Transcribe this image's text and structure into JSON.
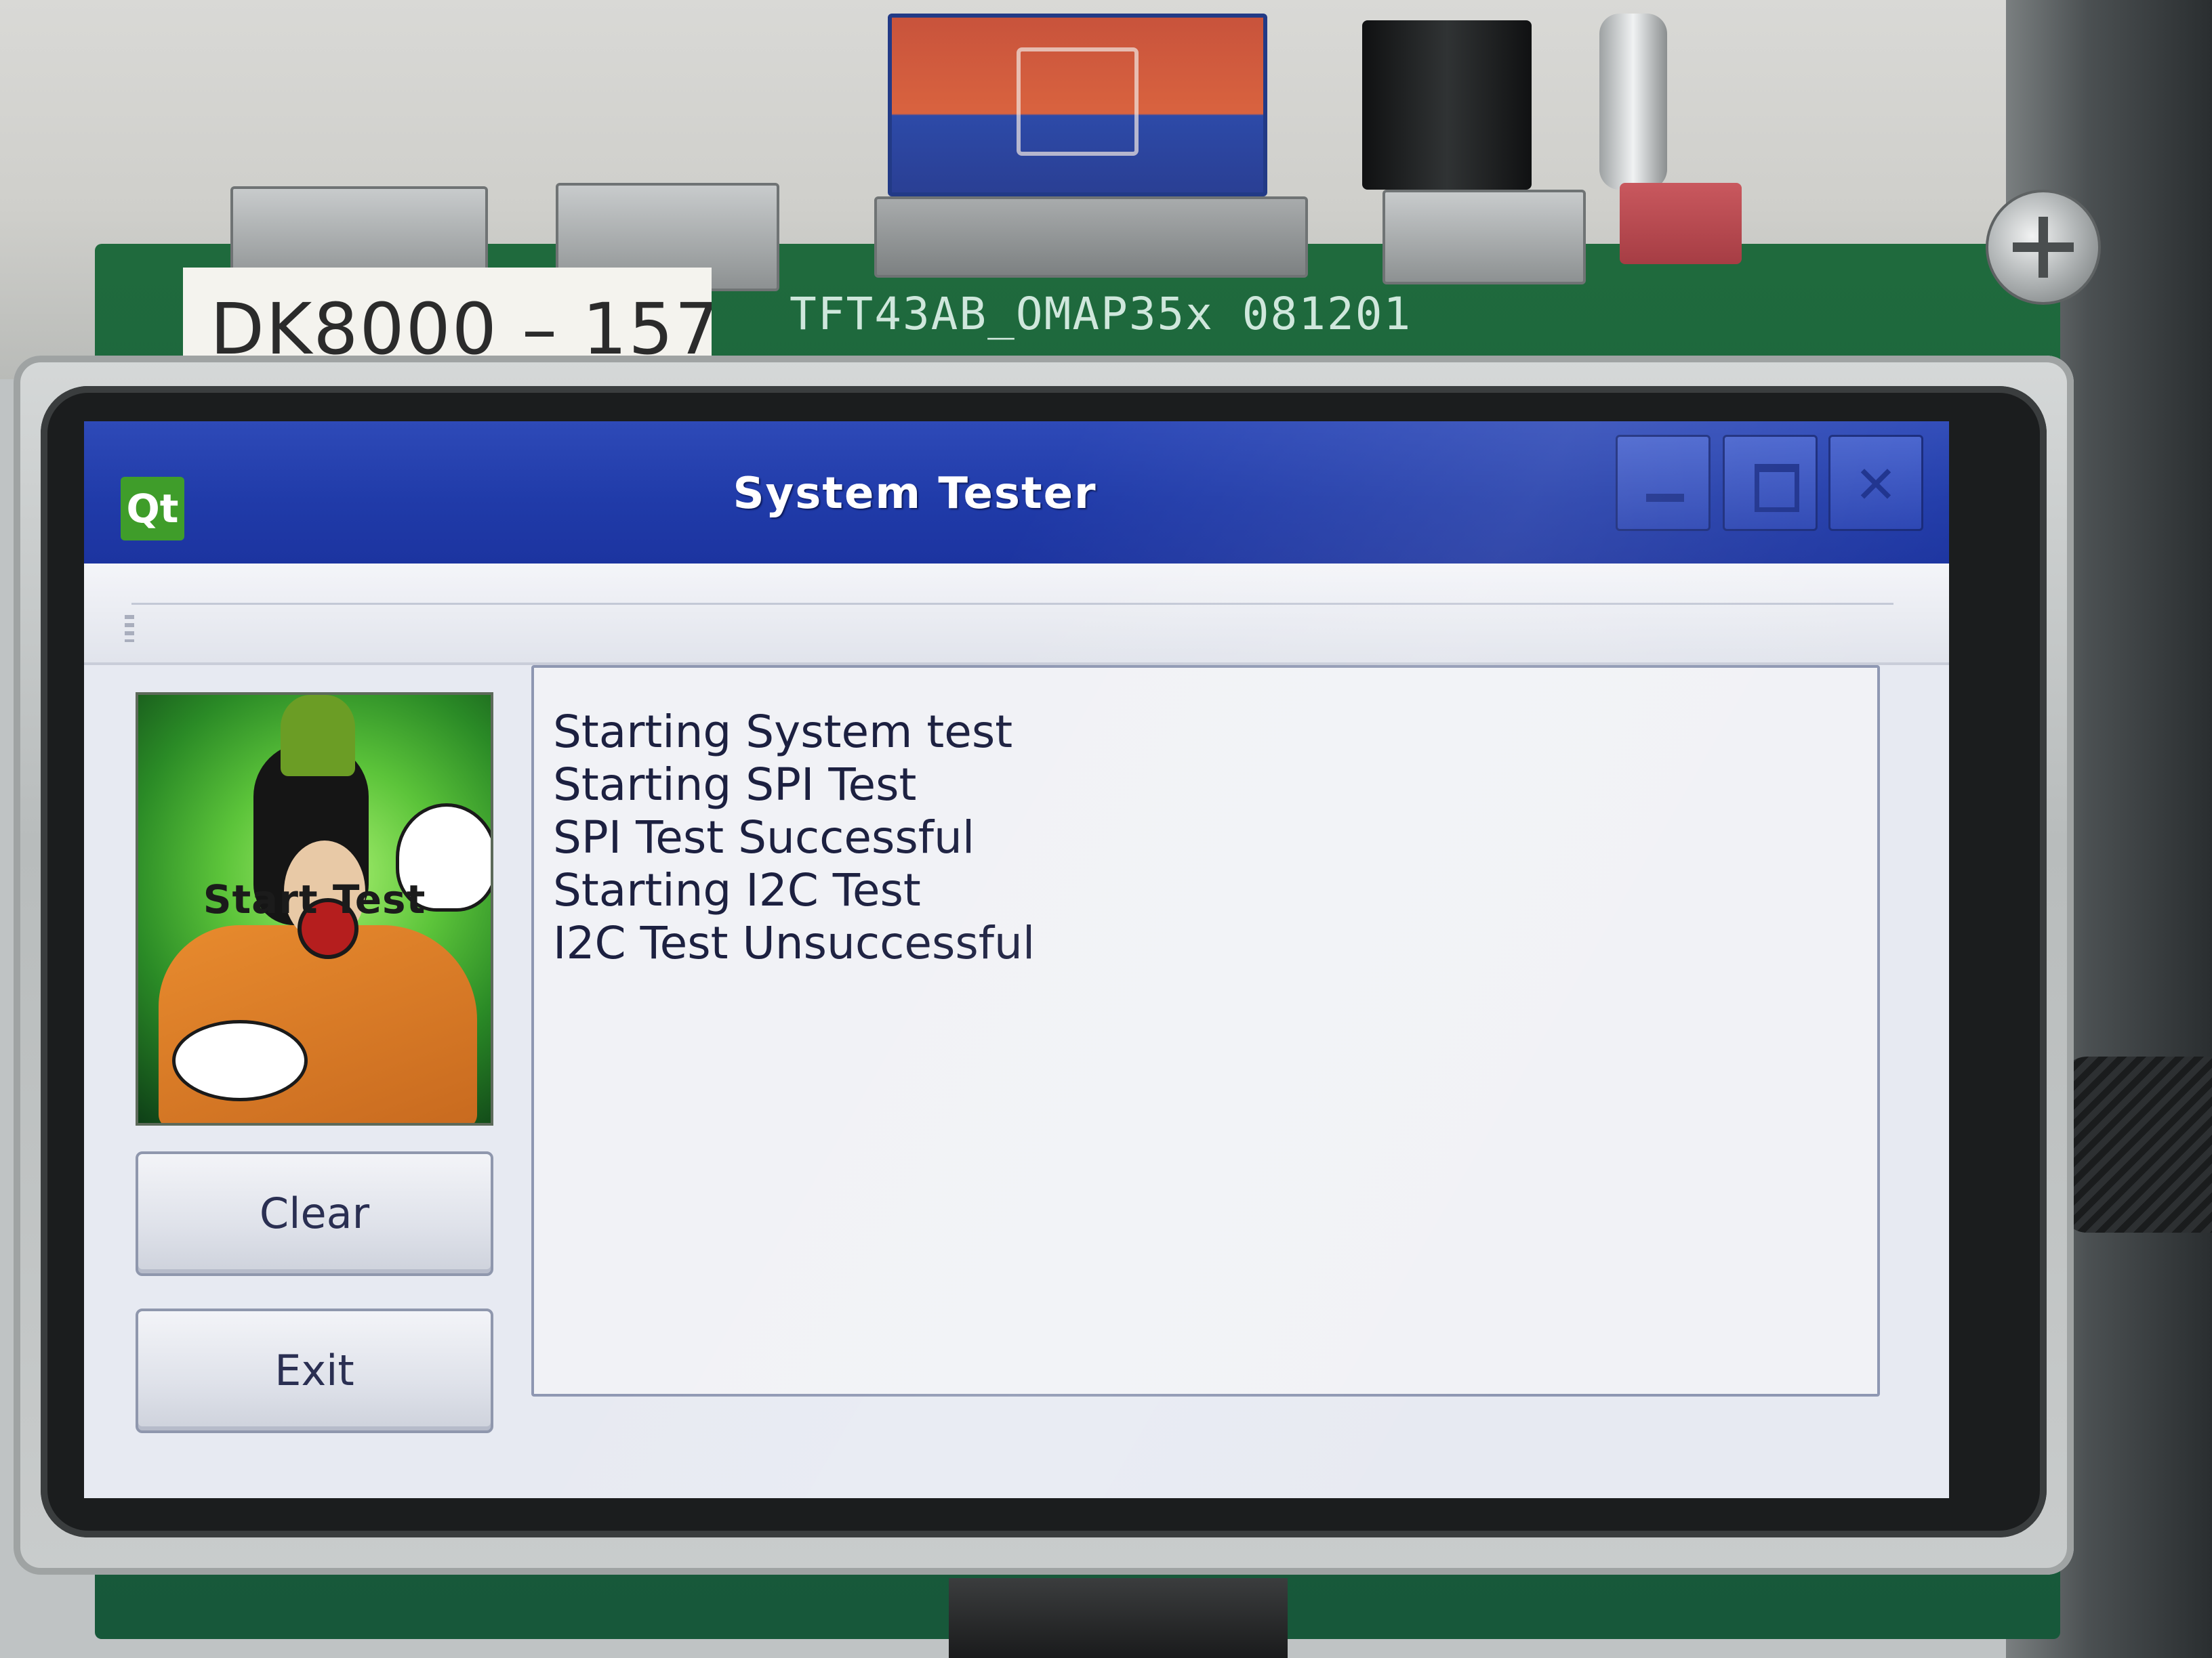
{
  "device": {
    "board_label": "DK8000 – 157",
    "silkscreen": "TFT43AB_OMAP35x  081201"
  },
  "window": {
    "title": "System Tester",
    "logo_text": "Qt",
    "title_bar_color": "#203ba9"
  },
  "left_panel": {
    "image_button_label": "Start Test",
    "clear_label": "Clear",
    "exit_label": "Exit"
  },
  "log": {
    "lines": [
      "Starting System test",
      "Starting SPI Test",
      "SPI Test Successful",
      "Starting I2C Test",
      "I2C Test Unsuccessful"
    ]
  },
  "icons": {
    "app": "qt-logo-icon",
    "minimize": "minimize-icon",
    "maximize": "maximize-icon",
    "close": "close-icon"
  }
}
